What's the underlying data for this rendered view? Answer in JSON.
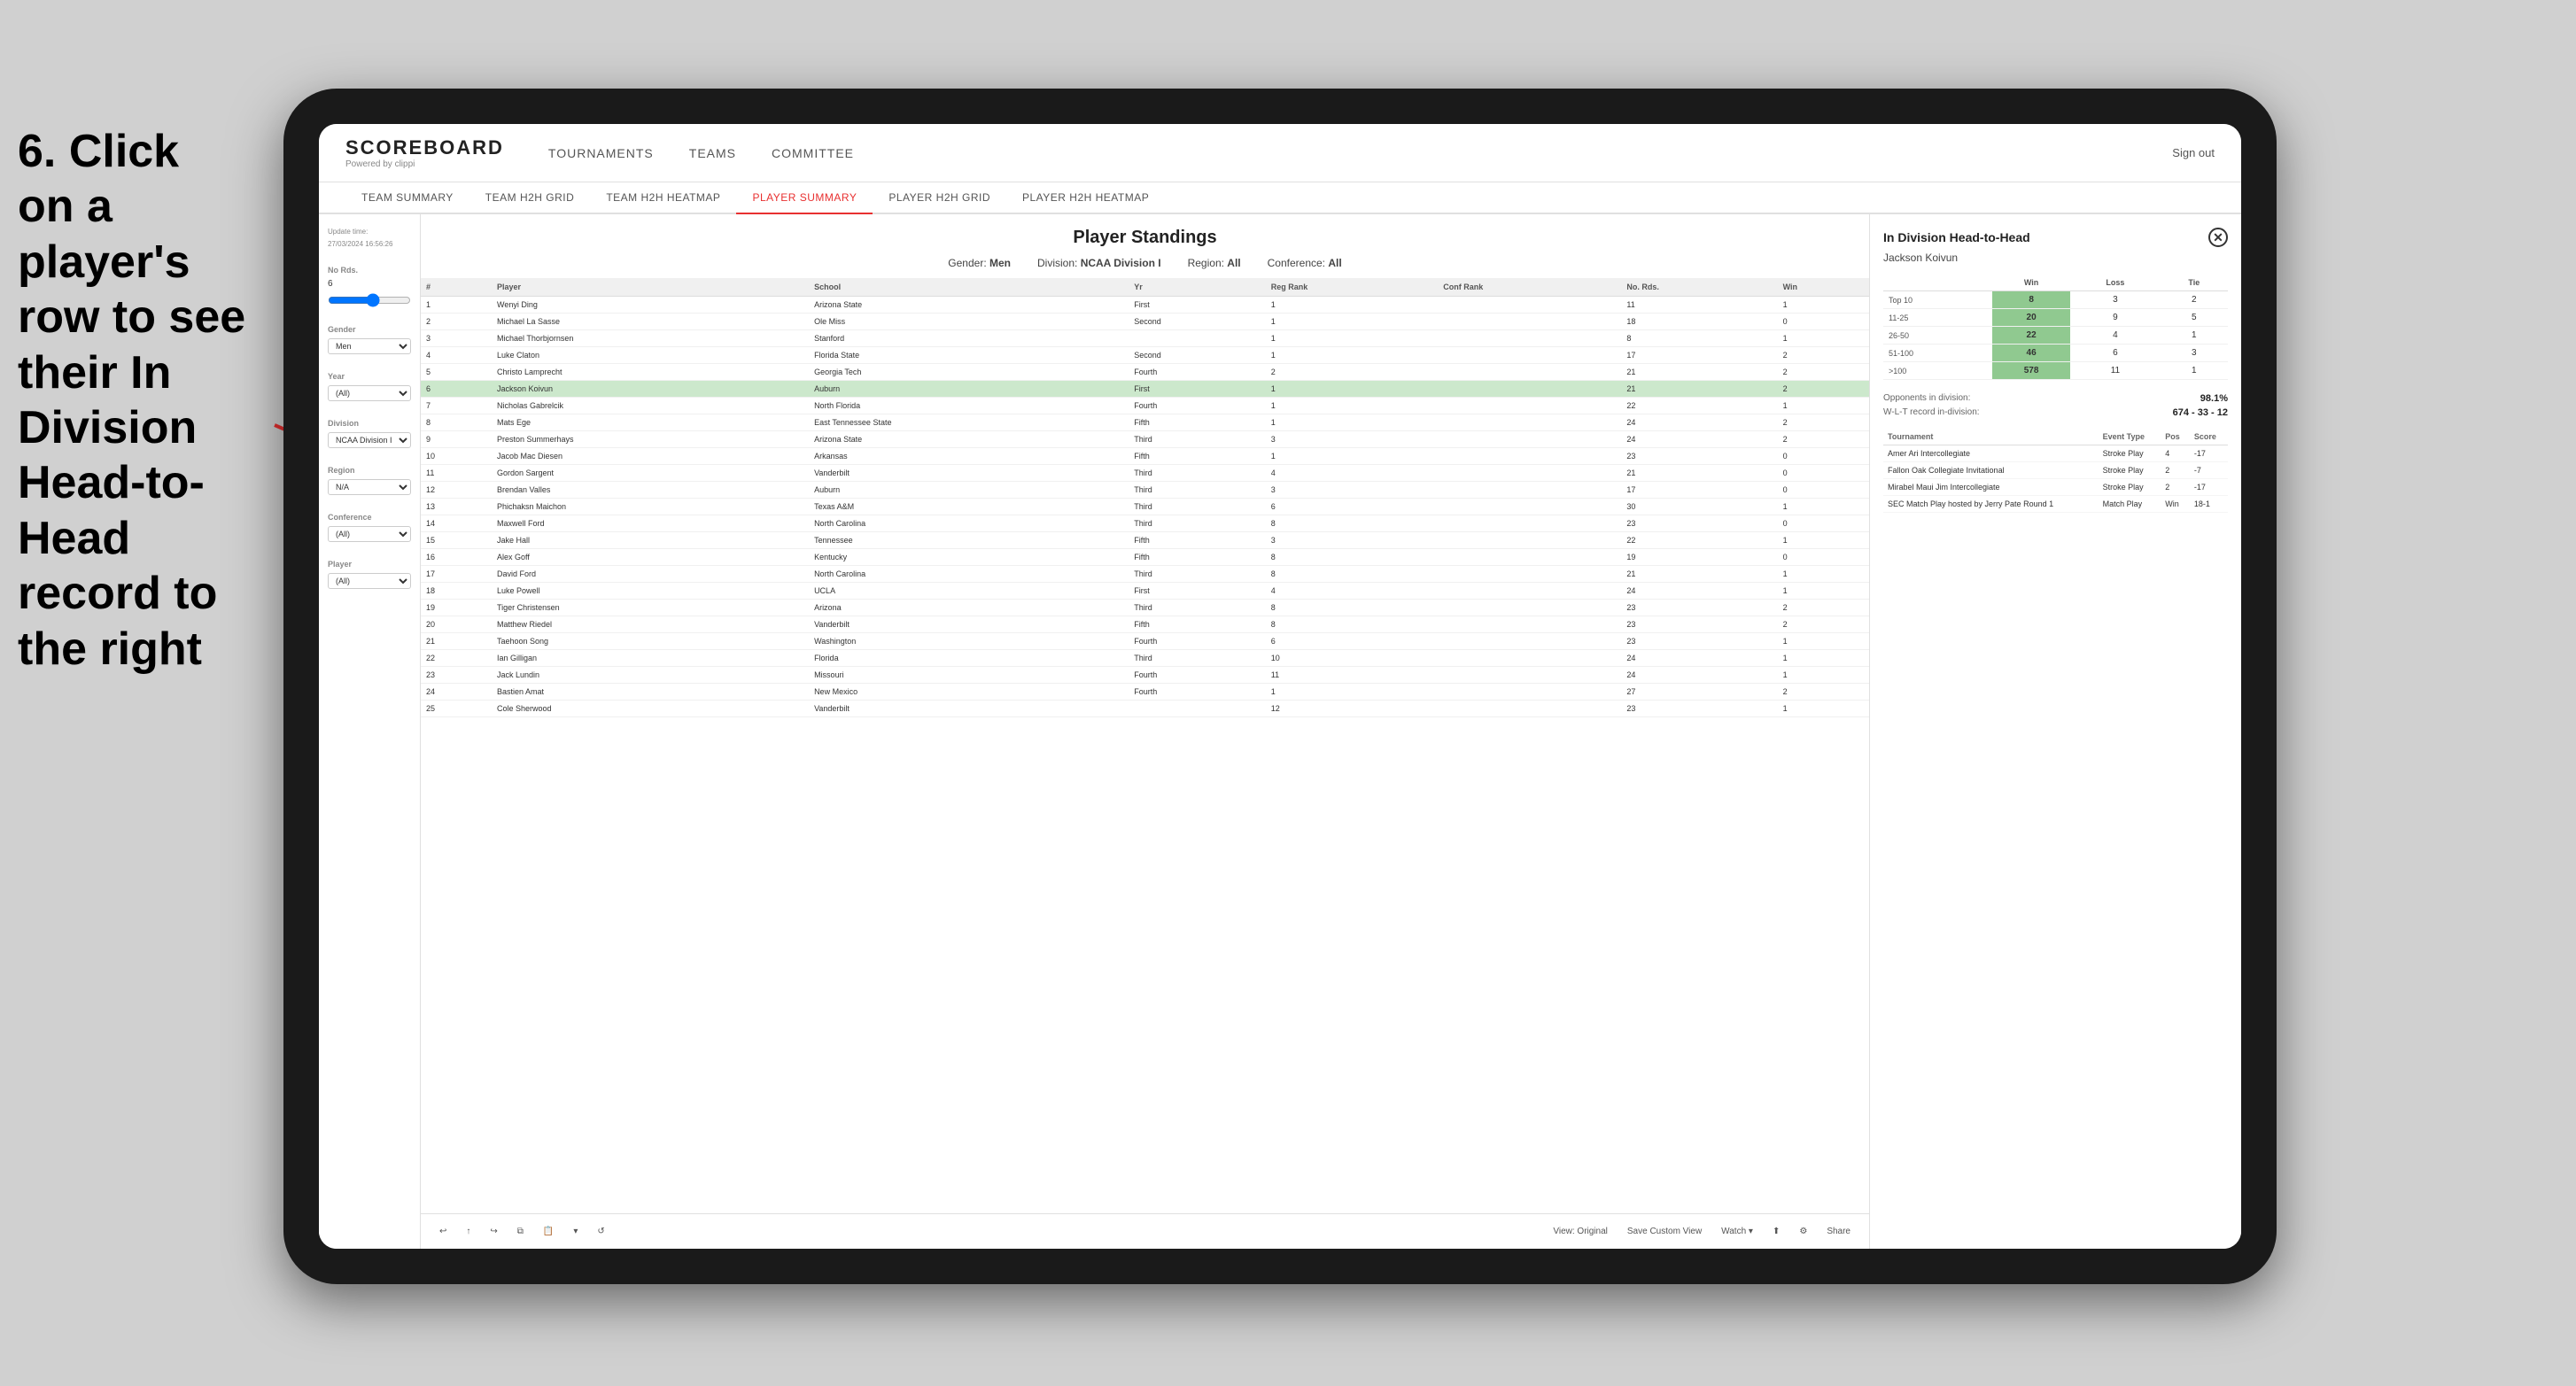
{
  "instruction": {
    "text": "6. Click on a player's row to see their In Division Head-to-Head record to the right"
  },
  "nav": {
    "logo": "SCOREBOARD",
    "logo_sub": "Powered by clippi",
    "links": [
      "TOURNAMENTS",
      "TEAMS",
      "COMMITTEE"
    ],
    "sign_out": "Sign out"
  },
  "sub_nav": {
    "items": [
      "TEAM SUMMARY",
      "TEAM H2H GRID",
      "TEAM H2H HEATMAP",
      "PLAYER SUMMARY",
      "PLAYER H2H GRID",
      "PLAYER H2H HEATMAP"
    ],
    "active": "PLAYER SUMMARY"
  },
  "sidebar": {
    "update_time_label": "Update time:",
    "update_time_value": "27/03/2024 16:56:26",
    "no_rds_label": "No Rds.",
    "no_rds_value": "6",
    "gender_label": "Gender",
    "gender_value": "Men",
    "year_label": "Year",
    "year_value": "(All)",
    "division_label": "Division",
    "division_value": "NCAA Division I",
    "region_label": "Region",
    "region_value": "N/A",
    "conference_label": "Conference",
    "conference_value": "(All)",
    "player_label": "Player",
    "player_value": "(All)"
  },
  "standings": {
    "title": "Player Standings",
    "gender": "Men",
    "division": "NCAA Division I",
    "region": "All",
    "conference": "All",
    "columns": [
      "#",
      "Player",
      "School",
      "Yr",
      "Reg Rank",
      "Conf Rank",
      "No. Rds.",
      "Win"
    ],
    "rows": [
      {
        "num": 1,
        "player": "Wenyi Ding",
        "school": "Arizona State",
        "yr": "First",
        "reg_rank": 1,
        "conf_rank": "",
        "no_rds": 11,
        "win": 1
      },
      {
        "num": 2,
        "player": "Michael La Sasse",
        "school": "Ole Miss",
        "yr": "Second",
        "reg_rank": 1,
        "conf_rank": "",
        "no_rds": 18,
        "win": 0
      },
      {
        "num": 3,
        "player": "Michael Thorbjornsen",
        "school": "Stanford",
        "yr": "",
        "reg_rank": 1,
        "conf_rank": "",
        "no_rds": 8,
        "win": 1
      },
      {
        "num": 4,
        "player": "Luke Claton",
        "school": "Florida State",
        "yr": "Second",
        "reg_rank": 1,
        "conf_rank": "",
        "no_rds": 17,
        "win": 2
      },
      {
        "num": 5,
        "player": "Christo Lamprecht",
        "school": "Georgia Tech",
        "yr": "Fourth",
        "reg_rank": 2,
        "conf_rank": "",
        "no_rds": 21,
        "win": 2
      },
      {
        "num": 6,
        "player": "Jackson Koivun",
        "school": "Auburn",
        "yr": "First",
        "reg_rank": 1,
        "conf_rank": "",
        "no_rds": 21,
        "win": 2,
        "selected": true
      },
      {
        "num": 7,
        "player": "Nicholas Gabrelcik",
        "school": "North Florida",
        "yr": "Fourth",
        "reg_rank": 1,
        "conf_rank": "",
        "no_rds": 22,
        "win": 1
      },
      {
        "num": 8,
        "player": "Mats Ege",
        "school": "East Tennessee State",
        "yr": "Fifth",
        "reg_rank": 1,
        "conf_rank": "",
        "no_rds": 24,
        "win": 2
      },
      {
        "num": 9,
        "player": "Preston Summerhays",
        "school": "Arizona State",
        "yr": "Third",
        "reg_rank": 3,
        "conf_rank": "",
        "no_rds": 24,
        "win": 2
      },
      {
        "num": 10,
        "player": "Jacob Mac Diesen",
        "school": "Arkansas",
        "yr": "Fifth",
        "reg_rank": 1,
        "conf_rank": "",
        "no_rds": 23,
        "win": 0
      },
      {
        "num": 11,
        "player": "Gordon Sargent",
        "school": "Vanderbilt",
        "yr": "Third",
        "reg_rank": 4,
        "conf_rank": "",
        "no_rds": 21,
        "win": 0
      },
      {
        "num": 12,
        "player": "Brendan Valles",
        "school": "Auburn",
        "yr": "Third",
        "reg_rank": 3,
        "conf_rank": "",
        "no_rds": 17,
        "win": 0
      },
      {
        "num": 13,
        "player": "Phichaksn Maichon",
        "school": "Texas A&M",
        "yr": "Third",
        "reg_rank": 6,
        "conf_rank": "",
        "no_rds": 30,
        "win": 1
      },
      {
        "num": 14,
        "player": "Maxwell Ford",
        "school": "North Carolina",
        "yr": "Third",
        "reg_rank": 8,
        "conf_rank": "",
        "no_rds": 23,
        "win": 0
      },
      {
        "num": 15,
        "player": "Jake Hall",
        "school": "Tennessee",
        "yr": "Fifth",
        "reg_rank": 3,
        "conf_rank": "",
        "no_rds": 22,
        "win": 1
      },
      {
        "num": 16,
        "player": "Alex Goff",
        "school": "Kentucky",
        "yr": "Fifth",
        "reg_rank": 8,
        "conf_rank": "",
        "no_rds": 19,
        "win": 0
      },
      {
        "num": 17,
        "player": "David Ford",
        "school": "North Carolina",
        "yr": "Third",
        "reg_rank": 8,
        "conf_rank": "",
        "no_rds": 21,
        "win": 1
      },
      {
        "num": 18,
        "player": "Luke Powell",
        "school": "UCLA",
        "yr": "First",
        "reg_rank": 4,
        "conf_rank": "",
        "no_rds": 24,
        "win": 1
      },
      {
        "num": 19,
        "player": "Tiger Christensen",
        "school": "Arizona",
        "yr": "Third",
        "reg_rank": 8,
        "conf_rank": "",
        "no_rds": 23,
        "win": 2
      },
      {
        "num": 20,
        "player": "Matthew Riedel",
        "school": "Vanderbilt",
        "yr": "Fifth",
        "reg_rank": 8,
        "conf_rank": "",
        "no_rds": 23,
        "win": 2
      },
      {
        "num": 21,
        "player": "Taehoon Song",
        "school": "Washington",
        "yr": "Fourth",
        "reg_rank": 6,
        "conf_rank": "",
        "no_rds": 23,
        "win": 1
      },
      {
        "num": 22,
        "player": "Ian Gilligan",
        "school": "Florida",
        "yr": "Third",
        "reg_rank": 10,
        "conf_rank": "",
        "no_rds": 24,
        "win": 1
      },
      {
        "num": 23,
        "player": "Jack Lundin",
        "school": "Missouri",
        "yr": "Fourth",
        "reg_rank": 11,
        "conf_rank": "",
        "no_rds": 24,
        "win": 1
      },
      {
        "num": 24,
        "player": "Bastien Amat",
        "school": "New Mexico",
        "yr": "Fourth",
        "reg_rank": 1,
        "conf_rank": "",
        "no_rds": 27,
        "win": 2
      },
      {
        "num": 25,
        "player": "Cole Sherwood",
        "school": "Vanderbilt",
        "yr": "",
        "reg_rank": 12,
        "conf_rank": "",
        "no_rds": 23,
        "win": 1
      }
    ]
  },
  "h2h": {
    "title": "In Division Head-to-Head",
    "player_name": "Jackson Koivun",
    "table_headers": [
      "",
      "Win",
      "Loss",
      "Tie"
    ],
    "rows": [
      {
        "rank": "Top 10",
        "win": 8,
        "loss": 3,
        "tie": 2
      },
      {
        "rank": "11-25",
        "win": 20,
        "loss": 9,
        "tie": 5
      },
      {
        "rank": "26-50",
        "win": 22,
        "loss": 4,
        "tie": 1
      },
      {
        "rank": "51-100",
        "win": 46,
        "loss": 6,
        "tie": 3
      },
      {
        "rank": ">100",
        "win": 578,
        "loss": 11,
        "tie": 1
      }
    ],
    "opponents_label": "Opponents in division:",
    "opponents_value": "98.1%",
    "wlt_label": "W-L-T record in-division:",
    "wlt_value": "674 - 33 - 12",
    "tournament_headers": [
      "Tournament",
      "Event Type",
      "Pos",
      "Score"
    ],
    "tournaments": [
      {
        "name": "Amer Ari Intercollegiate",
        "type": "Stroke Play",
        "pos": 4,
        "score": "-17"
      },
      {
        "name": "Fallon Oak Collegiate Invitational",
        "type": "Stroke Play",
        "pos": 2,
        "score": "-7"
      },
      {
        "name": "Mirabel Maui Jim Intercollegiate",
        "type": "Stroke Play",
        "pos": 2,
        "score": "-17"
      },
      {
        "name": "SEC Match Play hosted by Jerry Pate Round 1",
        "type": "Match Play",
        "pos": "Win",
        "score": "18-1"
      }
    ]
  },
  "toolbar": {
    "view_original": "View: Original",
    "save_custom": "Save Custom View",
    "watch": "Watch ▾",
    "share": "Share"
  }
}
